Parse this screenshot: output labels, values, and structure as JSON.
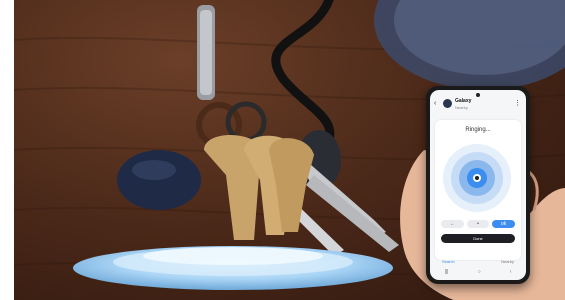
{
  "phone": {
    "device_name": "Galaxy",
    "device_subtitle": "Nearby",
    "status": "Ringing...",
    "controls": [
      "←",
      "•",
      "ok"
    ],
    "primary_action": "Done",
    "tabs": [
      "Search",
      "Nearby"
    ]
  },
  "colors": {
    "wood": "#4d2a1a",
    "accent_blue": "#3b8ef0",
    "tag_navy": "#1f2b46",
    "brass": "#c9a46a",
    "silver": "#c7c9cc"
  },
  "icons": [
    "back-icon",
    "more-icon",
    "home-icon"
  ]
}
